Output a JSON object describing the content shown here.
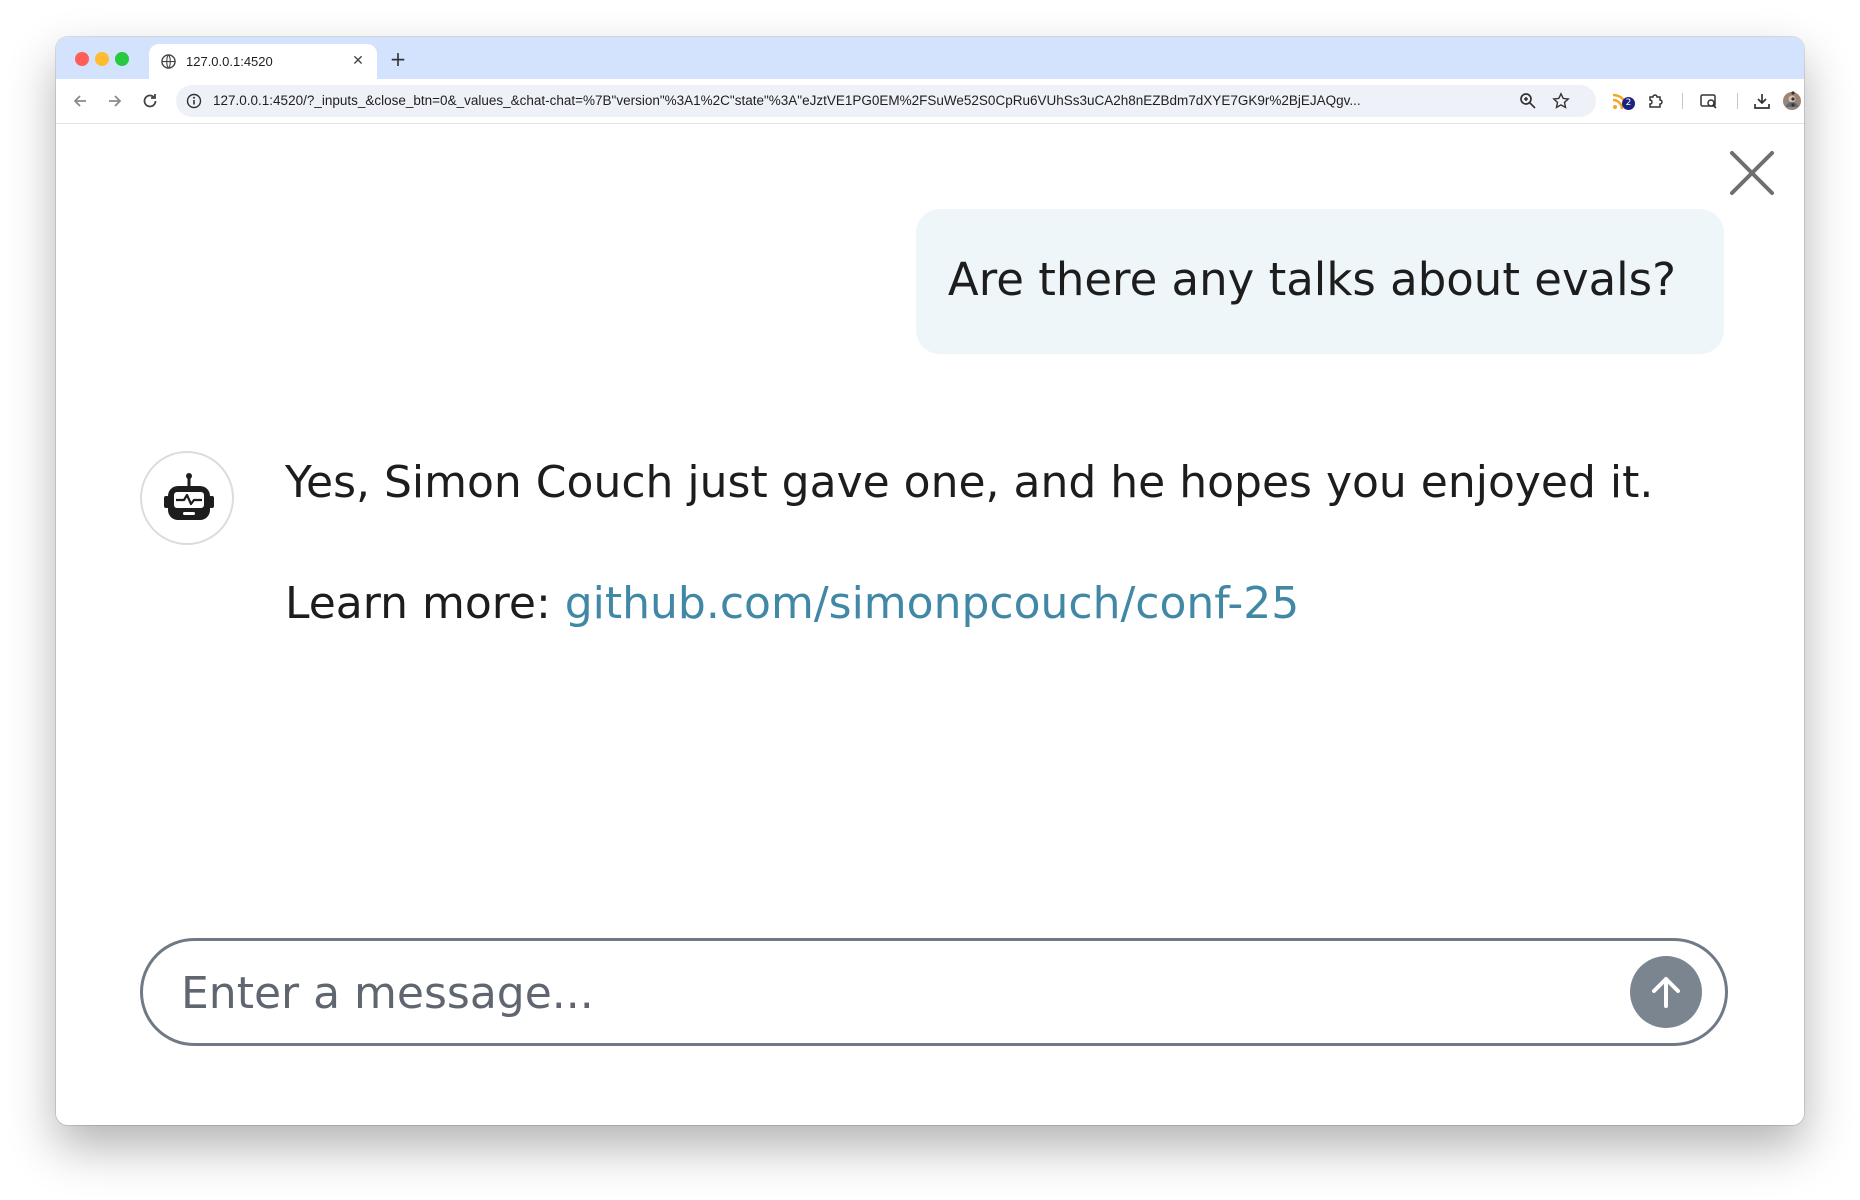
{
  "browser": {
    "tab_title": "127.0.0.1:4520",
    "tab_close_glyph": "✕",
    "new_tab_glyph": "+",
    "url": "127.0.0.1:4520/?_inputs_&close_btn=0&_values_&chat-chat=%7B\"version\"%3A1%2C\"state\"%3A\"eJztVE1PG0EM%2FSuWe52S0CpRu6VUhSs3uCA2h8nEZBdm7dXYE7GK9r%2BjEJAQgv...",
    "extension_badge": "2",
    "icons": [
      "back-arrow-icon",
      "forward-arrow-icon",
      "reload-icon",
      "site-info-icon",
      "zoom-icon",
      "bookmark-star-icon",
      "rss-extension-icon",
      "puzzle-extensions-icon",
      "tab-search-icon",
      "download-icon",
      "profile-avatar-icon",
      "more-menu-icon"
    ]
  },
  "chat": {
    "user_message": "Are there any talks about evals?",
    "assistant_line1": "Yes, Simon Couch just gave one, and he hopes you enjoyed it.",
    "assistant_learn_more_label": "Learn more: ",
    "assistant_link": "github.com/simonpcouch/conf-25",
    "input_placeholder": "Enter a message...",
    "accent_link_color": "#4188a6",
    "user_bubble_color": "#eef6fa",
    "send_button_color": "#7b8590"
  }
}
